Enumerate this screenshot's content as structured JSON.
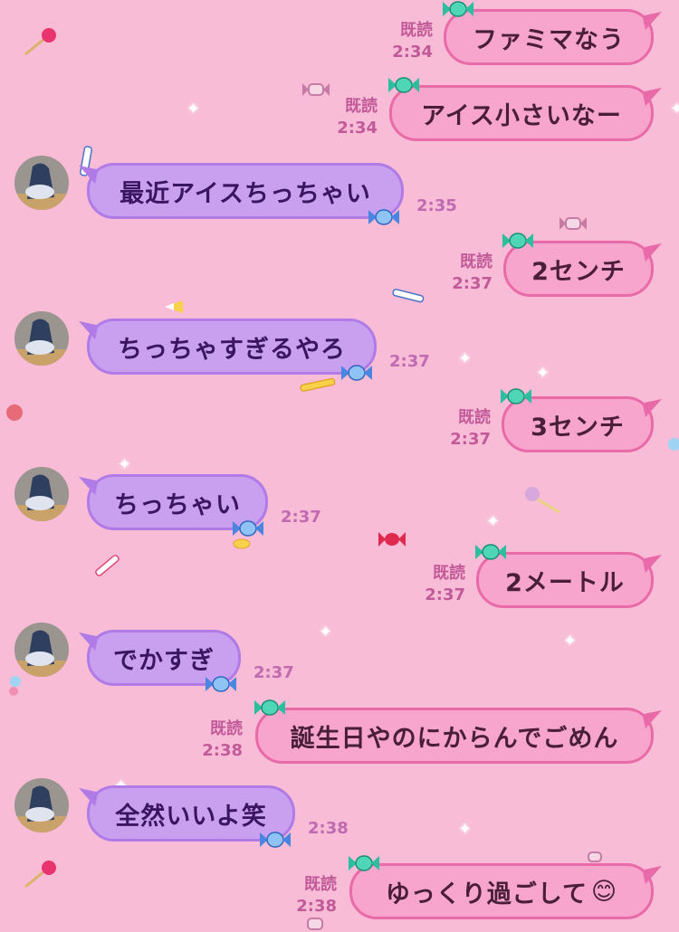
{
  "colors": {
    "background": "#f8bcd6",
    "outgoing_bubble": "#f7a5cc",
    "outgoing_border": "#e96aa8",
    "incoming_bubble": "#c9a0f0",
    "incoming_border": "#b07be6",
    "meta_text": "#c25a9a"
  },
  "messages": [
    {
      "side": "out",
      "text": "ファミマなう",
      "read": "既読",
      "time": "2:34"
    },
    {
      "side": "out",
      "text": "アイス小さいなー",
      "read": "既読",
      "time": "2:34"
    },
    {
      "side": "in",
      "text": "最近アイスちっちゃい",
      "time": "2:35",
      "avatar": "avatar-photo"
    },
    {
      "side": "out",
      "text": "2センチ",
      "read": "既読",
      "time": "2:37"
    },
    {
      "side": "in",
      "text": "ちっちゃすぎるやろ",
      "time": "2:37",
      "avatar": "avatar-photo"
    },
    {
      "side": "out",
      "text": "3センチ",
      "read": "既読",
      "time": "2:37"
    },
    {
      "side": "in",
      "text": "ちっちゃい",
      "time": "2:37",
      "avatar": "avatar-photo"
    },
    {
      "side": "out",
      "text": "2メートル",
      "read": "既読",
      "time": "2:37"
    },
    {
      "side": "in",
      "text": "でかすぎ",
      "time": "2:37",
      "avatar": "avatar-photo"
    },
    {
      "side": "out",
      "text": "誕生日やのにからんでごめん",
      "read": "既読",
      "time": "2:38"
    },
    {
      "side": "in",
      "text": "全然いいよ笑",
      "time": "2:38",
      "avatar": "avatar-photo"
    },
    {
      "side": "out",
      "text": "ゆっくり過ごして",
      "emoji": "😊",
      "read": "既読",
      "time": "2:38"
    }
  ]
}
